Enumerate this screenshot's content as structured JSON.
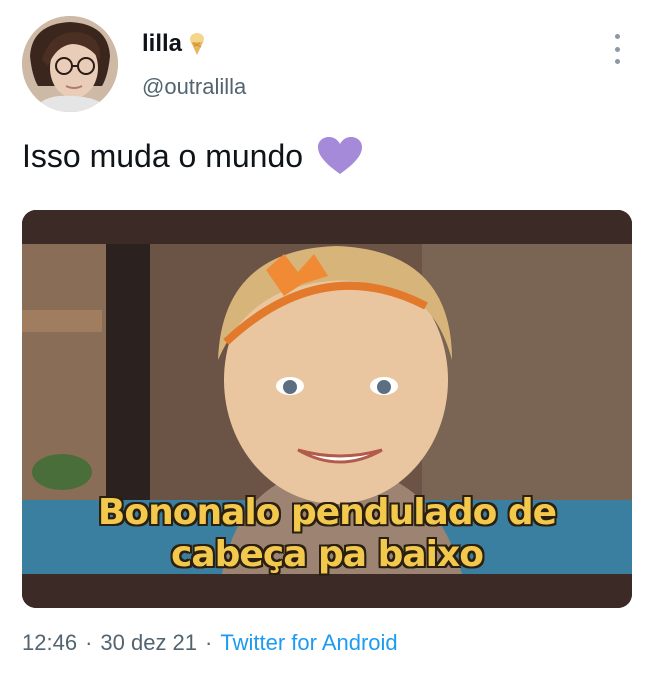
{
  "author": {
    "display_name": "lilla",
    "name_emoji": "ice-cream-icon",
    "handle": "@outralilla"
  },
  "tweet": {
    "text": "Isso muda o mundo",
    "emoji": "purple-heart-icon",
    "emoji_color": "#a48ad8"
  },
  "media": {
    "caption_line1": "Bononalo pendulado de",
    "caption_line2": "cabeça pa baixo",
    "caption_color": "#f2c94c"
  },
  "meta": {
    "time": "12:46",
    "sep1": "·",
    "date": "30 dez 21",
    "sep2": "·",
    "source": "Twitter for Android",
    "source_color": "#1d9bf0"
  }
}
